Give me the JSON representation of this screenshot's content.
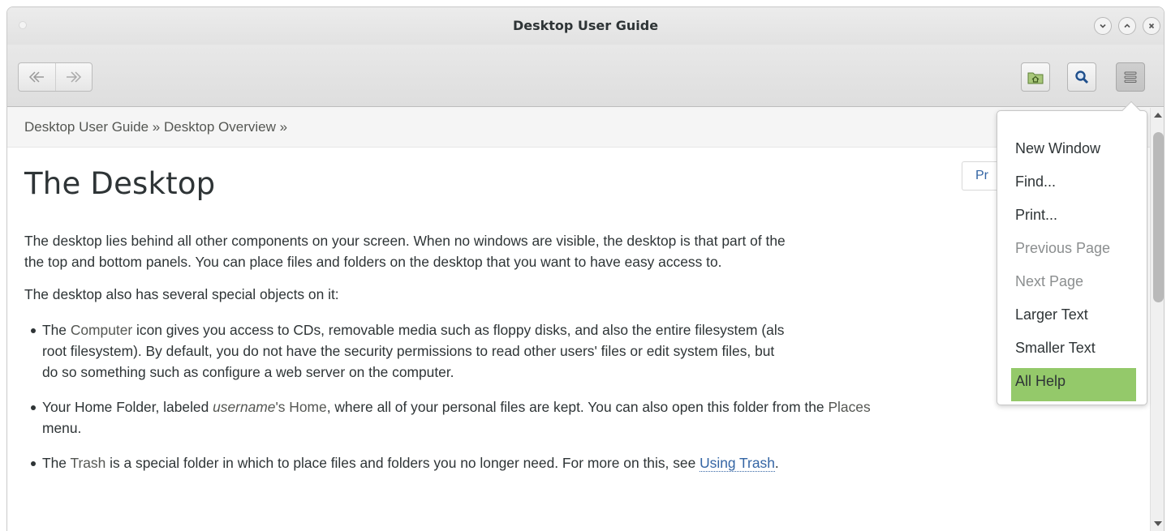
{
  "window": {
    "title": "Desktop User Guide"
  },
  "toolbar": {
    "back_icon": "back-arrow-icon",
    "forward_icon": "forward-arrow-icon",
    "home_icon": "folder-home-icon",
    "search_icon": "magnifier-icon",
    "menu_icon": "hamburger-menu-icon"
  },
  "breadcrumb": "Desktop User Guide » Desktop Overview »",
  "page": {
    "title": "The Desktop",
    "prev_partial": "Pr",
    "para1_line1": "The desktop lies behind all other components on your screen. When no windows are visible, the desktop is that part of the",
    "para1_line2": "the top and bottom panels. You can place files and folders on the desktop that you want to have easy access to.",
    "para2": "The desktop also has several special objects on it:",
    "bullets": [
      {
        "pre": "The ",
        "gui": "Computer",
        "line1_post": " icon gives you access to CDs, removable media such as floppy disks, and also the entire filesystem (als",
        "line2": "root filesystem). By default, you do not have the security permissions to read other users' files or edit system files, but",
        "line3": "do so something such as configure a web server on the computer."
      },
      {
        "pre": "Your Home Folder, labeled ",
        "em": "username",
        "gui": "'s Home",
        "line1_post": ", where all of your personal files are kept. You can also open this folder from the ",
        "gui2": "Places",
        "line2": "menu."
      },
      {
        "pre": "The ",
        "gui": "Trash",
        "line1_post": " is a special folder in which to place files and folders you no longer need. For more on this, see ",
        "link": "Using Trash",
        "end": "."
      }
    ]
  },
  "menu": {
    "items": [
      {
        "label": "New Window",
        "state": "normal"
      },
      {
        "label": "Find...",
        "state": "normal"
      },
      {
        "label": "Print...",
        "state": "normal"
      },
      {
        "label": "Previous Page",
        "state": "disabled"
      },
      {
        "label": "Next Page",
        "state": "disabled"
      },
      {
        "label": "Larger Text",
        "state": "normal"
      },
      {
        "label": "Smaller Text",
        "state": "normal"
      },
      {
        "label": "All Help",
        "state": "selected"
      }
    ]
  },
  "colors": {
    "selection": "#94c96a",
    "link": "#3465a4",
    "text": "#2e3436",
    "disabled": "#8b8e8f"
  }
}
